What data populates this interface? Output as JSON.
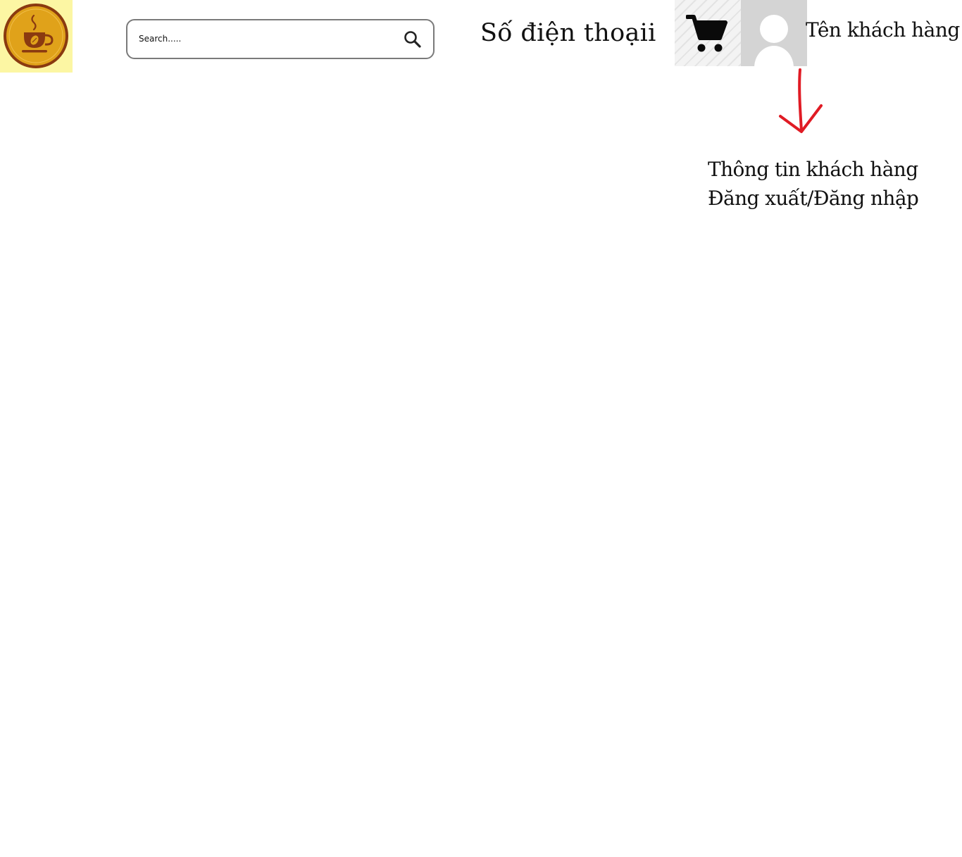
{
  "header": {
    "logo": {
      "icon": "coffee-cup-logo-icon",
      "background": "#fcf6a3",
      "ring_color": "#8a3a10",
      "fill_color": "#e0a21a"
    },
    "search": {
      "placeholder": "Search.....",
      "value": "",
      "icon": "search-icon"
    },
    "phone_label": "Số điện thoạii",
    "cart": {
      "icon": "shopping-cart-icon"
    },
    "avatar": {
      "icon": "user-avatar-icon"
    },
    "customer_name": "Tên khách hàng"
  },
  "annotation": {
    "arrow_icon": "arrow-down-icon",
    "arrow_color": "#e01b24"
  },
  "account_menu": {
    "items": [
      {
        "label": "Thông tin khách hàng"
      },
      {
        "label": "Đăng xuất/Đăng nhập"
      }
    ]
  }
}
